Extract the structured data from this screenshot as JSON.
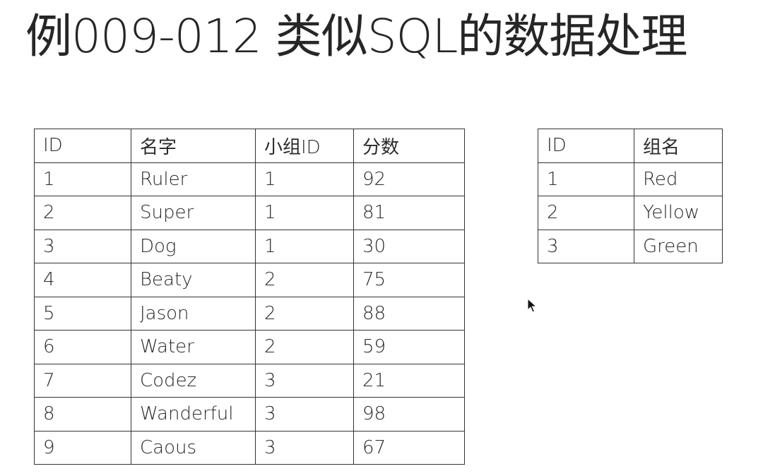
{
  "title": "例009-012 类似SQL的数据处理",
  "students_table": {
    "headers": [
      "ID",
      "名字",
      "小组ID",
      "分数"
    ],
    "rows": [
      [
        "1",
        "Ruler",
        "1",
        "92"
      ],
      [
        "2",
        "Super",
        "1",
        "81"
      ],
      [
        "3",
        "Dog",
        "1",
        "30"
      ],
      [
        "4",
        "Beaty",
        "2",
        "75"
      ],
      [
        "5",
        "Jason",
        "2",
        "88"
      ],
      [
        "6",
        "Water",
        "2",
        "59"
      ],
      [
        "7",
        "Codez",
        "3",
        "21"
      ],
      [
        "8",
        "Wanderful",
        "3",
        "98"
      ],
      [
        "9",
        "Caous",
        "3",
        "67"
      ]
    ]
  },
  "groups_table": {
    "headers": [
      "ID",
      "组名"
    ],
    "rows": [
      [
        "1",
        "Red"
      ],
      [
        "2",
        "Yellow"
      ],
      [
        "3",
        "Green"
      ]
    ]
  },
  "icons": {
    "cursor": "mouse-pointer-icon"
  }
}
